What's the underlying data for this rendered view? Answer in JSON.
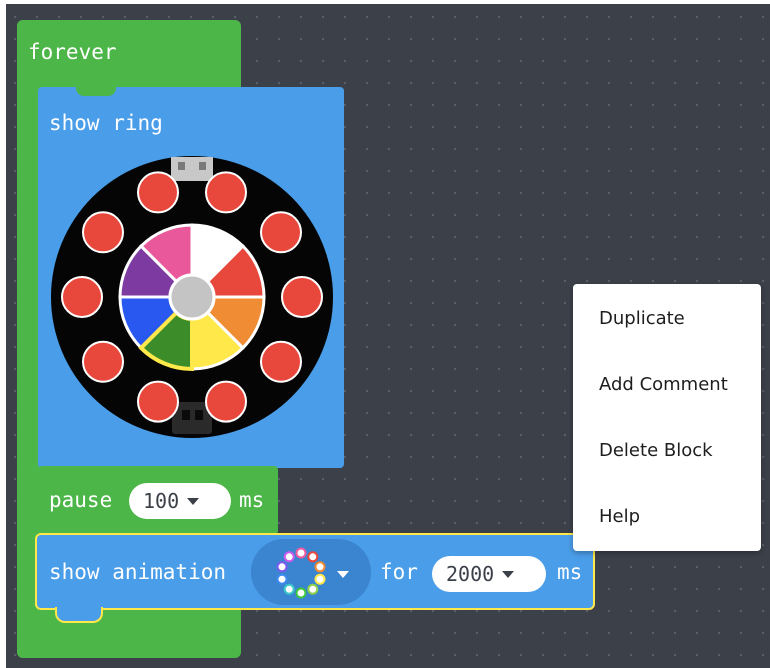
{
  "forever_block": {
    "label": "forever"
  },
  "show_ring_block": {
    "label": "show ring",
    "outer_led_color": "#e8473c",
    "wheel_segments": [
      "#ffffff",
      "#e8473c",
      "#f08c33",
      "#ffe84a",
      "#3c8c2a",
      "#2858f0",
      "#7d3aa0",
      "#e8589a"
    ],
    "selected_segment": 4
  },
  "pause_block": {
    "label": "pause",
    "value": "100",
    "unit": "ms"
  },
  "show_animation_block": {
    "label": "show animation",
    "for_label": "for",
    "value": "2000",
    "unit": "ms",
    "animation_icon": "rainbow-ring-icon"
  },
  "context_menu": {
    "items": [
      "Duplicate",
      "Add Comment",
      "Delete Block",
      "Help"
    ]
  },
  "colors": {
    "workspace_bg": "#3c4049",
    "loops_green": "#4db648",
    "light_blue": "#4a9de8",
    "selection_yellow": "#ffe84a"
  }
}
